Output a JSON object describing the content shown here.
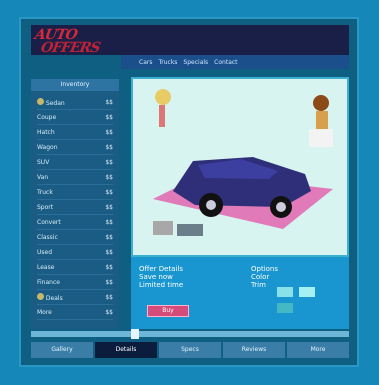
{
  "app": {
    "logo_line1": "AUTO",
    "logo_line2": "OFFERS"
  },
  "nav": {
    "items": [
      "Cars",
      "Trucks",
      "Specials",
      "Contact"
    ]
  },
  "sidebar": {
    "header": "Inventory",
    "rows": [
      {
        "label": "Sedan",
        "value": "$$",
        "icon": "coin-icon"
      },
      {
        "label": "Coupe",
        "value": "$$",
        "icon": ""
      },
      {
        "label": "Hatch",
        "value": "$$",
        "icon": ""
      },
      {
        "label": "Wagon",
        "value": "$$",
        "icon": ""
      },
      {
        "label": "SUV",
        "value": "$$",
        "icon": ""
      },
      {
        "label": "Van",
        "value": "$$",
        "icon": ""
      },
      {
        "label": "Truck",
        "value": "$$",
        "icon": ""
      },
      {
        "label": "Sport",
        "value": "$$",
        "icon": ""
      },
      {
        "label": "Convert",
        "value": "$$",
        "icon": ""
      },
      {
        "label": "Classic",
        "value": "$$",
        "icon": ""
      },
      {
        "label": "Used",
        "value": "$$",
        "icon": ""
      },
      {
        "label": "Lease",
        "value": "$$",
        "icon": ""
      },
      {
        "label": "Finance",
        "value": "$$",
        "icon": ""
      },
      {
        "label": "Deals",
        "value": "$$",
        "icon": "coin-icon"
      },
      {
        "label": "More",
        "value": "$$",
        "icon": ""
      }
    ]
  },
  "info": {
    "left_title": "Offer Details",
    "left_lines": [
      "Save now",
      "Limited time"
    ],
    "right_title": "Options",
    "right_lines": [
      "Color",
      "Trim"
    ],
    "cta_label": "Buy"
  },
  "tabs": {
    "items": [
      "Gallery",
      "Details",
      "Specs",
      "Reviews",
      "More"
    ],
    "active_index": 1
  },
  "colors": {
    "car": "#2e2f78",
    "stage": "#e07ab8"
  }
}
